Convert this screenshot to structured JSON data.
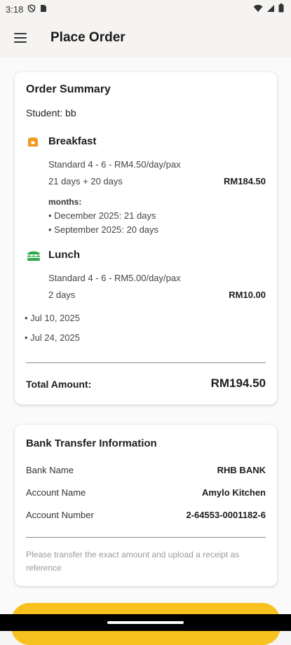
{
  "status_bar": {
    "time": "3:18"
  },
  "app_bar": {
    "title": "Place Order"
  },
  "order_summary": {
    "title": "Order Summary",
    "student": "Student: bb",
    "breakfast": {
      "name": "Breakfast",
      "plan": "Standard 4 - 6 - RM4.50/day/pax",
      "days": "21 days + 20 days",
      "amount": "RM184.50",
      "months_label": "months:",
      "months": [
        "• December 2025: 21 days",
        "• September 2025: 20 days"
      ]
    },
    "lunch": {
      "name": "Lunch",
      "plan": "Standard 4 - 6 - RM5.00/day/pax",
      "days": "2 days",
      "amount": "RM10.00",
      "dates": [
        "• Jul 10, 2025",
        "• Jul 24, 2025"
      ]
    },
    "total_label": "Total Amount:",
    "total_value": "RM194.50"
  },
  "bank_info": {
    "title": "Bank Transfer Information",
    "rows": [
      {
        "label": "Bank Name",
        "value": "RHB BANK"
      },
      {
        "label": "Account Name",
        "value": "Amylo Kitchen"
      },
      {
        "label": "Account Number",
        "value": "2-64553-0001182-6"
      }
    ],
    "note": "Please transfer the exact amount and upload a receipt as reference"
  },
  "colors": {
    "accent": "#f7c21f",
    "breakfast_icon": "#f29a1f",
    "lunch_icon": "#2faa4b"
  },
  "icons": [
    "menu-icon",
    "shield-icon",
    "sim-icon",
    "wifi-icon",
    "signal-icon",
    "battery-icon",
    "breakfast-icon",
    "lunch-icon"
  ]
}
